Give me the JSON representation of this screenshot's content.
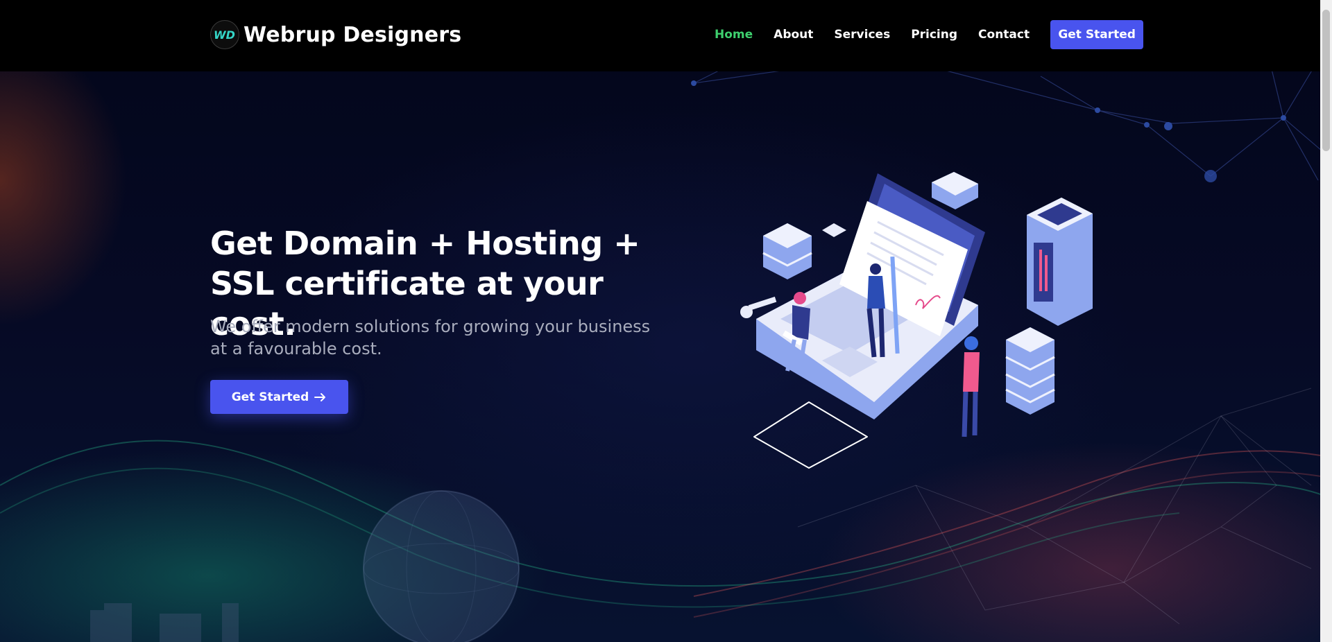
{
  "brand": {
    "logo_mark": "WD",
    "name": "Webrup Designers"
  },
  "nav": {
    "items": [
      {
        "label": "Home",
        "active": true
      },
      {
        "label": "About",
        "active": false
      },
      {
        "label": "Services",
        "active": false
      },
      {
        "label": "Pricing",
        "active": false
      },
      {
        "label": "Contact",
        "active": false
      }
    ],
    "cta_label": "Get Started"
  },
  "hero": {
    "title": "Get Domain + Hosting + SSL certificate at your cost.",
    "subtitle": "We offer modern solutions for growing your business at a favourable cost.",
    "cta_label": "Get Started",
    "cta_icon": "arrow-right-icon",
    "illustration": "isometric-laptop-hosting-illustration"
  },
  "colors": {
    "header_bg": "#000000",
    "accent": "#4954ee",
    "nav_active": "#3ecf6e",
    "text": "#ffffff",
    "subtext": "#a9adbd"
  }
}
